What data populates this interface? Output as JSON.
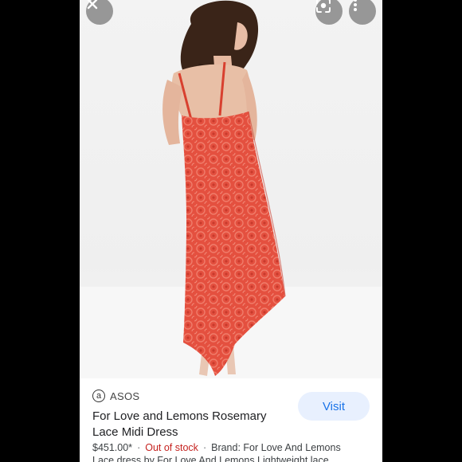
{
  "overlay": {
    "close_icon": "close-icon",
    "lens_icon": "lens-icon",
    "more_icon": "more-vert-icon"
  },
  "product": {
    "source_logo": "a",
    "source_name": "ASOS",
    "title": "For Love and Lemons Rosemary Lace Midi Dress",
    "visit_label": "Visit",
    "price": "$451.00*",
    "stock": "Out of stock",
    "brand": "Brand: For Love And Lemons",
    "description": "Lace dress by For Love And Lemons Lightweight lace"
  },
  "colors": {
    "visit_bg": "#e8f0fe",
    "visit_text": "#1a73e8",
    "out_of_stock": "#c5221f",
    "dress": "#e4503f"
  }
}
